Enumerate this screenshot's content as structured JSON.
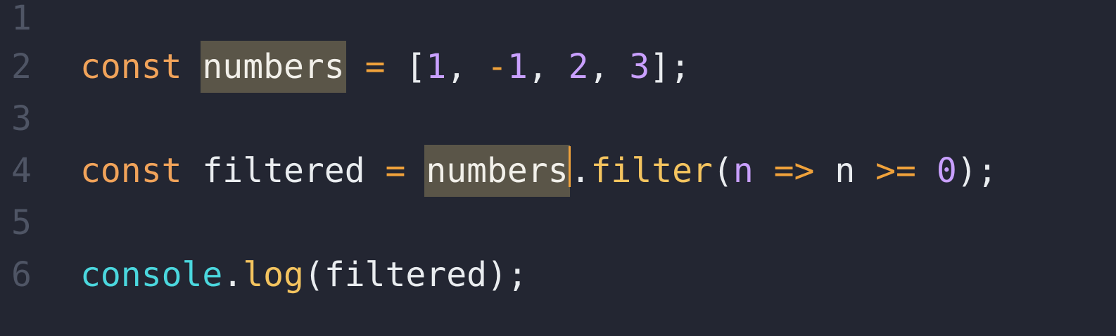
{
  "editor": {
    "lines": [
      {
        "number": "1",
        "tokens": []
      },
      {
        "number": "2",
        "tokens": [
          {
            "text": "const",
            "kind": "kw"
          },
          {
            "text": " ",
            "kind": "plain"
          },
          {
            "text": "numbers",
            "kind": "hl"
          },
          {
            "text": " ",
            "kind": "plain"
          },
          {
            "text": "=",
            "kind": "op"
          },
          {
            "text": " ",
            "kind": "plain"
          },
          {
            "text": "[",
            "kind": "punct"
          },
          {
            "text": "1",
            "kind": "num"
          },
          {
            "text": ",",
            "kind": "punct"
          },
          {
            "text": " ",
            "kind": "plain"
          },
          {
            "text": "-",
            "kind": "op"
          },
          {
            "text": "1",
            "kind": "num"
          },
          {
            "text": ",",
            "kind": "punct"
          },
          {
            "text": " ",
            "kind": "plain"
          },
          {
            "text": "2",
            "kind": "num"
          },
          {
            "text": ",",
            "kind": "punct"
          },
          {
            "text": " ",
            "kind": "plain"
          },
          {
            "text": "3",
            "kind": "num"
          },
          {
            "text": "];",
            "kind": "punct"
          }
        ]
      },
      {
        "number": "3",
        "tokens": []
      },
      {
        "number": "4",
        "tokens": [
          {
            "text": "const",
            "kind": "kw"
          },
          {
            "text": " ",
            "kind": "plain"
          },
          {
            "text": "filtered",
            "kind": "plain"
          },
          {
            "text": " ",
            "kind": "plain"
          },
          {
            "text": "=",
            "kind": "op"
          },
          {
            "text": " ",
            "kind": "plain"
          },
          {
            "text": "numbers",
            "kind": "hl"
          },
          {
            "text": "",
            "kind": "cursor"
          },
          {
            "text": ".",
            "kind": "punct"
          },
          {
            "text": "filter",
            "kind": "method"
          },
          {
            "text": "(",
            "kind": "punct"
          },
          {
            "text": "n",
            "kind": "param"
          },
          {
            "text": " ",
            "kind": "plain"
          },
          {
            "text": "=>",
            "kind": "op"
          },
          {
            "text": " ",
            "kind": "plain"
          },
          {
            "text": "n",
            "kind": "plain"
          },
          {
            "text": " ",
            "kind": "plain"
          },
          {
            "text": ">=",
            "kind": "op"
          },
          {
            "text": " ",
            "kind": "plain"
          },
          {
            "text": "0",
            "kind": "num"
          },
          {
            "text": ");",
            "kind": "punct"
          }
        ]
      },
      {
        "number": "5",
        "tokens": []
      },
      {
        "number": "6",
        "tokens": [
          {
            "text": "console",
            "kind": "console"
          },
          {
            "text": ".",
            "kind": "punct"
          },
          {
            "text": "log",
            "kind": "method"
          },
          {
            "text": "(",
            "kind": "punct"
          },
          {
            "text": "filtered",
            "kind": "plain"
          },
          {
            "text": ");",
            "kind": "punct"
          }
        ]
      }
    ]
  },
  "theme": {
    "background": "#232632",
    "gutter": "#4f5565",
    "keyword": "#f1a35a",
    "operator": "#f0a23b",
    "number": "#c9a0ff",
    "plain": "#e9ecef",
    "console": "#4bd7de",
    "method": "#f4c45f",
    "highlight": "#5a5548",
    "cursor": "#f0a23b"
  }
}
